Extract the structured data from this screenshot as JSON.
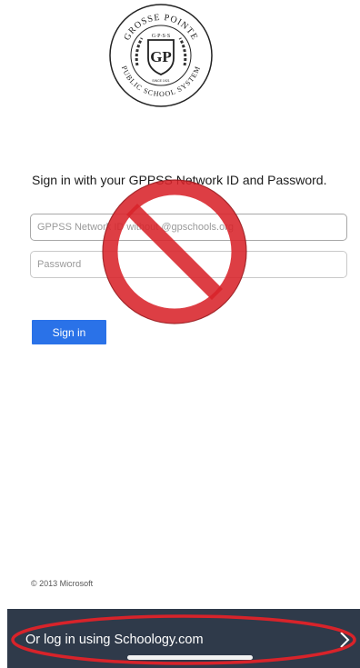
{
  "logo": {
    "top_text": "GROSSE POINTE",
    "bottom_text": "PUBLIC SCHOOL SYSTEM",
    "inner_text": "G·P·S·S",
    "monogram": "GP",
    "since": "SINCE 1921"
  },
  "form": {
    "instructions": "Sign in with your GPPSS Network ID and Password.",
    "username_placeholder": "GPPSS Network ID without @gpschools.org",
    "password_placeholder": "Password",
    "signin_label": "Sign in"
  },
  "footer": {
    "copyright": "© 2013 Microsoft"
  },
  "bottom_bar": {
    "link_label": "Or log in using Schoology.com"
  },
  "colors": {
    "accent": "#2a72e8",
    "bar": "#2f3a4a",
    "annotation_red": "#d8232a"
  },
  "icons": [
    "prohibition-icon",
    "chevron-right-icon",
    "logo-seal"
  ]
}
